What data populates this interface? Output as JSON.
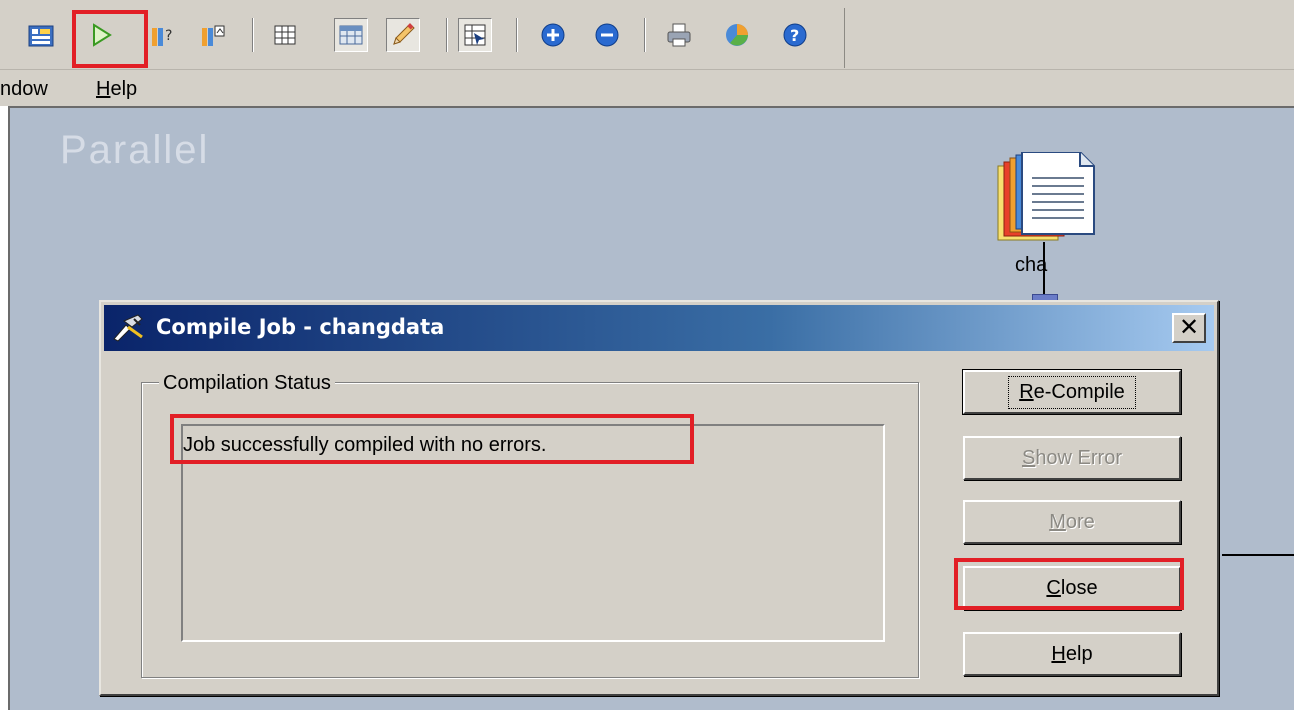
{
  "toolbar": {
    "buttons": [
      {
        "name": "job-properties-icon"
      },
      {
        "name": "compile-run-icon"
      },
      {
        "name": "run-icon"
      },
      {
        "name": "job-status-icon"
      },
      {
        "name": "grid-icon"
      },
      {
        "name": "table-definition-icon"
      },
      {
        "name": "annotation-pencil-icon"
      },
      {
        "name": "palette-icon"
      },
      {
        "name": "zoom-in-icon"
      },
      {
        "name": "zoom-out-icon"
      },
      {
        "name": "print-icon"
      },
      {
        "name": "chart-icon"
      },
      {
        "name": "help-icon"
      }
    ]
  },
  "menubar": {
    "window_label": "ndow",
    "help_mnemonic": "H",
    "help_rest": "elp"
  },
  "canvas": {
    "watermark": "Parallel",
    "stage_label": "cha"
  },
  "dialog": {
    "title": "Compile Job - changdata",
    "close_glyph": "✕",
    "group_label": "Compilation Status",
    "status_message": "Job successfully compiled with no errors.",
    "buttons": {
      "recompile": {
        "mnemonic": "R",
        "rest": "e-Compile"
      },
      "show_error": {
        "mnemonic": "S",
        "rest": "how Error"
      },
      "more": {
        "mnemonic": "M",
        "rest": "ore"
      },
      "close": {
        "mnemonic": "C",
        "rest": "lose"
      },
      "help": {
        "mnemonic": "H",
        "rest": "elp"
      }
    }
  },
  "colors": {
    "highlight": "#e21f26",
    "titlebar_start": "#0a246a",
    "titlebar_end": "#a6caf0",
    "canvas": "#b0bccc",
    "dialog_face": "#d4d0c8"
  }
}
